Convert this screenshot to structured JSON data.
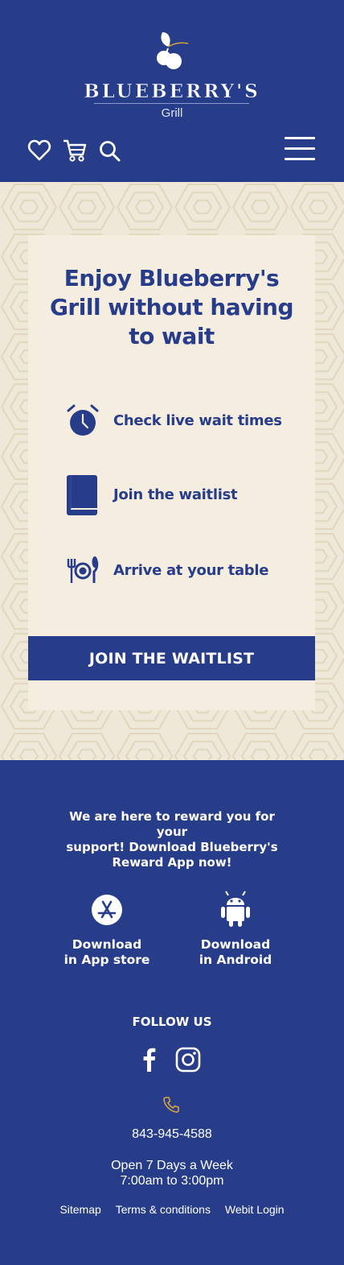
{
  "header": {
    "brand": "BLUEBERRY'S",
    "sub": "Grill",
    "icons": [
      "heart-icon",
      "cart-icon",
      "search-icon",
      "hamburger-menu-icon"
    ]
  },
  "hero": {
    "title_lines": [
      "Enjoy Blueberry's",
      "Grill without having",
      "to wait"
    ],
    "features": [
      {
        "icon": "alarm-clock-icon",
        "label": "Check live wait times"
      },
      {
        "icon": "book-icon",
        "label": "Join the waitlist"
      },
      {
        "icon": "utensils-plate-icon",
        "label": "Arrive at your table"
      }
    ],
    "cta": "JOIN THE WAITLIST"
  },
  "footer": {
    "reward_lines": [
      "We are here to reward you for your",
      "support! Download Blueberry's",
      "Reward App now!"
    ],
    "appstore_lines": [
      "Download",
      "in App store"
    ],
    "android_lines": [
      "Download",
      "in Android"
    ],
    "follow": "FOLLOW US",
    "phone": "843-945-4588",
    "hours_lines": [
      "Open 7 Days a Week",
      "7:00am to 3:00pm"
    ],
    "links": [
      "Sitemap",
      "Terms & conditions",
      "Webit Login"
    ]
  },
  "colors": {
    "navy": "#273d8a",
    "cream": "#f5eddf",
    "gold": "#d9a441"
  }
}
